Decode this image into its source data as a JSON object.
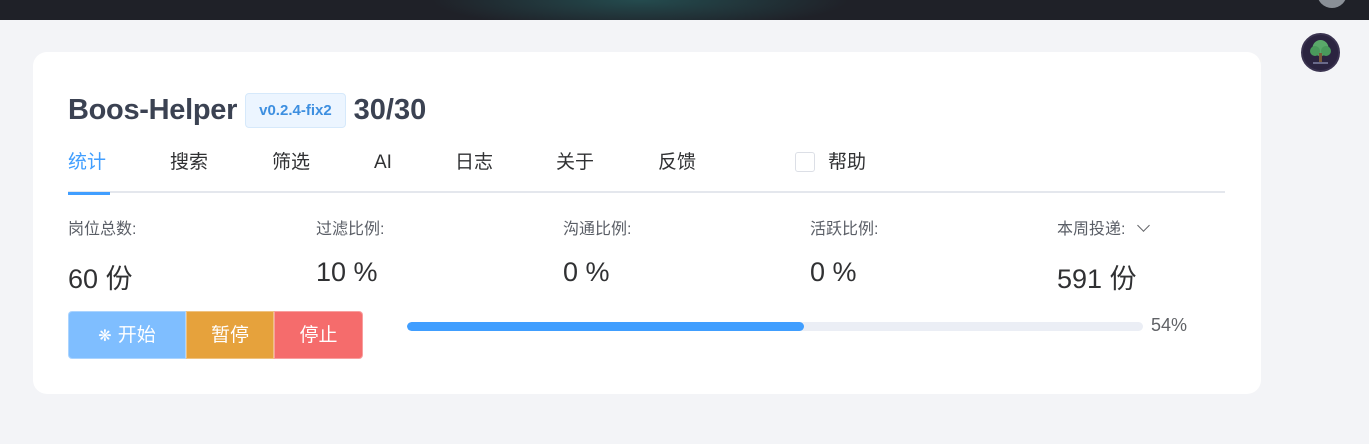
{
  "header": {
    "app_title": "Boos-Helper",
    "version": "v0.2.4-fix2",
    "count": "30/30"
  },
  "tabs": [
    {
      "label": "统计",
      "active": true
    },
    {
      "label": "搜索"
    },
    {
      "label": "筛选"
    },
    {
      "label": "AI"
    },
    {
      "label": "日志"
    },
    {
      "label": "关于"
    },
    {
      "label": "反馈"
    }
  ],
  "help": {
    "label": "帮助",
    "checked": false
  },
  "stats": [
    {
      "label": "岗位总数:",
      "value": "60 份"
    },
    {
      "label": "过滤比例:",
      "value": "10 %"
    },
    {
      "label": "沟通比例:",
      "value": "0 %"
    },
    {
      "label": "活跃比例:",
      "value": "0 %"
    },
    {
      "label": "本周投递:",
      "value": "591 份",
      "icon": "chevron-down-icon"
    }
  ],
  "buttons": {
    "start_label": "开始",
    "start_icon": "loading-spinner-icon",
    "pause_label": "暂停",
    "stop_label": "停止"
  },
  "progress": {
    "percent": 54,
    "label": "54%"
  },
  "colors": {
    "accent": "#409eff",
    "start": "#79bbff",
    "pause": "#e6a23c",
    "stop": "#f56c6c"
  }
}
